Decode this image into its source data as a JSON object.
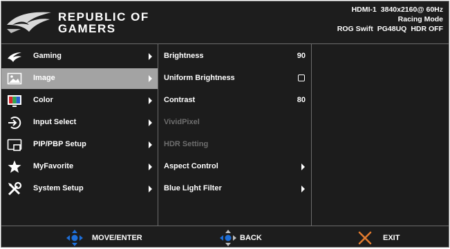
{
  "header": {
    "brand_line1": "REPUBLIC OF",
    "brand_line2": "GAMERS",
    "input": "HDMI-1",
    "resolution": "3840x2160@",
    "refresh": "60Hz",
    "mode": "Racing Mode",
    "model_series": "ROG Swift",
    "model": "PG48UQ",
    "hdr": "HDR OFF"
  },
  "menu": {
    "selected_index": 1,
    "items": [
      {
        "label": "Gaming",
        "icon": "rog-eye-icon"
      },
      {
        "label": "Image",
        "icon": "picture-icon"
      },
      {
        "label": "Color",
        "icon": "color-bars-icon"
      },
      {
        "label": "Input Select",
        "icon": "input-icon"
      },
      {
        "label": "PIP/PBP Setup",
        "icon": "pip-icon"
      },
      {
        "label": "MyFavorite",
        "icon": "star-icon"
      },
      {
        "label": "System Setup",
        "icon": "tools-icon"
      }
    ]
  },
  "submenu": {
    "items": [
      {
        "label": "Brightness",
        "value": "90",
        "state": "enabled"
      },
      {
        "label": "Uniform Brightness",
        "control": "checkbox",
        "checked": false,
        "state": "enabled"
      },
      {
        "label": "Contrast",
        "value": "80",
        "state": "enabled"
      },
      {
        "label": "VividPixel",
        "state": "disabled"
      },
      {
        "label": "HDR Setting",
        "state": "disabled"
      },
      {
        "label": "Aspect Control",
        "control": "submenu-arrow",
        "state": "enabled"
      },
      {
        "label": "Blue Light Filter",
        "control": "submenu-arrow",
        "state": "enabled"
      }
    ]
  },
  "footer": {
    "move_enter": "MOVE/ENTER",
    "back": "BACK",
    "exit": "EXIT"
  },
  "colors": {
    "background": "#1c1c1c",
    "selected_row": "#a3a3a3",
    "nav_blue": "#1e6fd9",
    "exit_cross": "#e07a2e",
    "disabled_text": "#6e6e6e"
  }
}
